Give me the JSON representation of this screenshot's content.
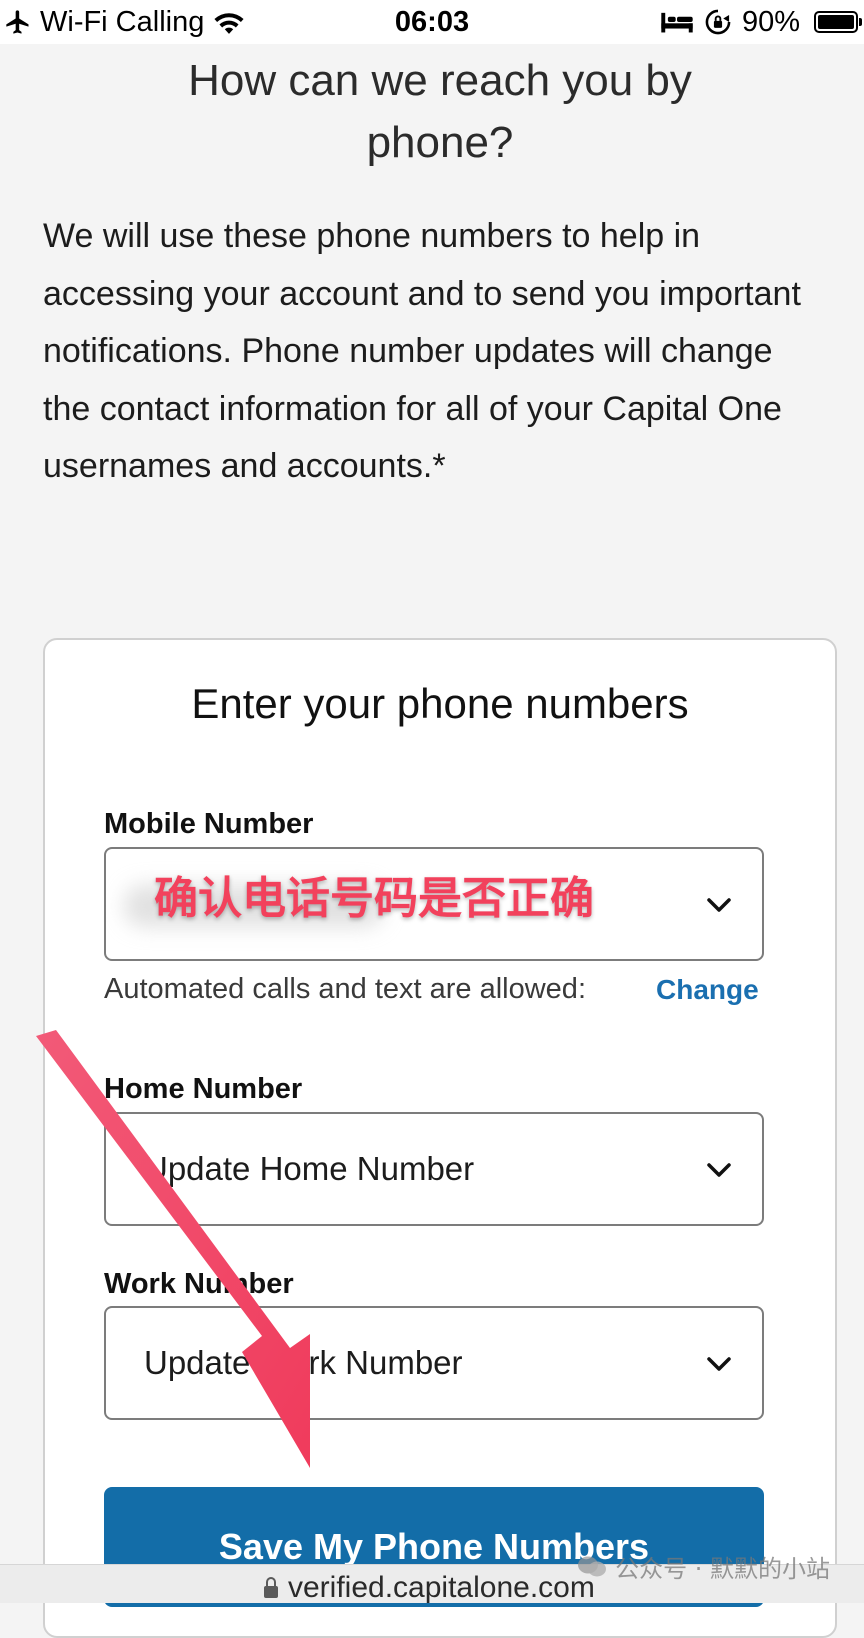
{
  "status_bar": {
    "carrier": "Wi-Fi Calling",
    "time": "06:03",
    "battery": "90%",
    "battery_level": 0.9
  },
  "page": {
    "heading": "How can we reach you by phone?",
    "intro": "We will use these phone numbers to help in accessing your account and to send you important notifications. Phone number updates will change the contact information for all of your Capital One usernames and accounts.*"
  },
  "card": {
    "title": "Enter your phone numbers",
    "mobile": {
      "label": "Mobile Number",
      "annotation": "确认电话号码是否正确"
    },
    "helper_text": "Automated calls and text are allowed:",
    "change_link": "Change",
    "home": {
      "label": "Home Number",
      "value": "Update Home Number"
    },
    "work": {
      "label": "Work Number",
      "value": "Update Work Number"
    },
    "save_button": "Save My Phone Numbers"
  },
  "address_bar": {
    "url": "verified.capitalone.com"
  },
  "watermark": {
    "text": "公众号 · 默默的小站"
  },
  "colors": {
    "brand_blue": "#136da8",
    "link_blue": "#1a6fb0",
    "annotation_red": "#f2415c"
  },
  "icons": [
    "airplane-icon",
    "wifi-icon",
    "bed-icon",
    "rotation-lock-icon",
    "battery-icon",
    "chevron-down-icon",
    "lock-icon",
    "wechat-icon"
  ]
}
